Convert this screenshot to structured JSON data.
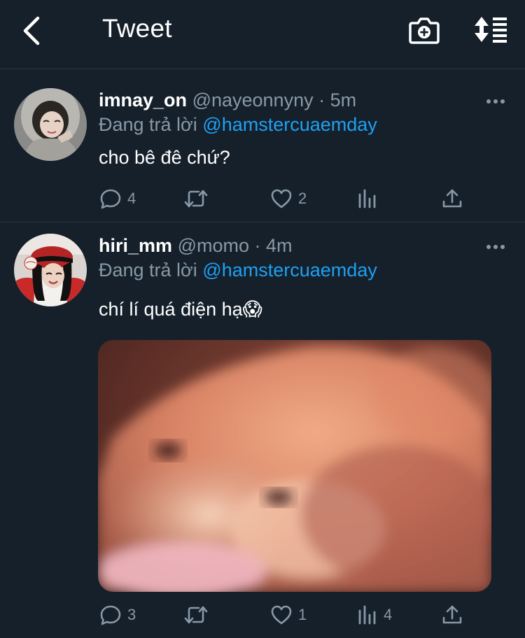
{
  "header": {
    "title": "Tweet",
    "back_icon": "chevron-left-icon",
    "camera_icon": "camera-plus-icon",
    "sort_icon": "sort-icon"
  },
  "colors": {
    "background": "#15202b",
    "secondary_text": "#8899a6",
    "link": "#1da1f2",
    "divider": "#2c3640"
  },
  "tweets": [
    {
      "username": "imnay_on",
      "handle": "@nayeonnyny",
      "separator": "·",
      "time": "5m",
      "replying_label": "Đang trả lời",
      "replying_to": "@hamstercuaemday",
      "text": "cho bê đê chứ?",
      "actions": {
        "replies": "4",
        "retweets": "",
        "likes": "2",
        "views": ""
      }
    },
    {
      "username": "hiri_mm",
      "handle": "@momo",
      "separator": "·",
      "time": "4m",
      "replying_label": "Đang trả lời",
      "replying_to": "@hamstercuaemday",
      "text": "chí lí quá điện hạ😱",
      "media": "blurry-face-photo",
      "actions": {
        "replies": "3",
        "retweets": "",
        "likes": "1",
        "views": "4"
      }
    }
  ]
}
